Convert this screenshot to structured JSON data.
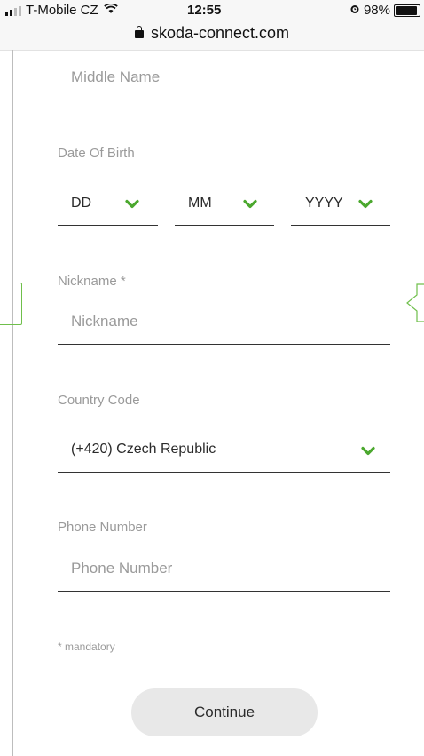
{
  "status_bar": {
    "carrier": "T-Mobile CZ",
    "time": "12:55",
    "battery": "98%",
    "url": "skoda-connect.com"
  },
  "form": {
    "middle_name": {
      "placeholder": "Middle Name"
    },
    "date_of_birth": {
      "label": "Date Of Birth",
      "day": "DD",
      "month": "MM",
      "year": "YYYY"
    },
    "nickname": {
      "label": "Nickname  *",
      "placeholder": "Nickname"
    },
    "country_code": {
      "label": "Country Code",
      "value": "(+420) Czech Republic"
    },
    "phone_number": {
      "label": "Phone Number",
      "placeholder": "Phone Number"
    },
    "mandatory_note": "* mandatory",
    "continue_label": "Continue"
  },
  "colors": {
    "accent_green": "#4ba82e",
    "button_bg": "#e8e8e8"
  }
}
